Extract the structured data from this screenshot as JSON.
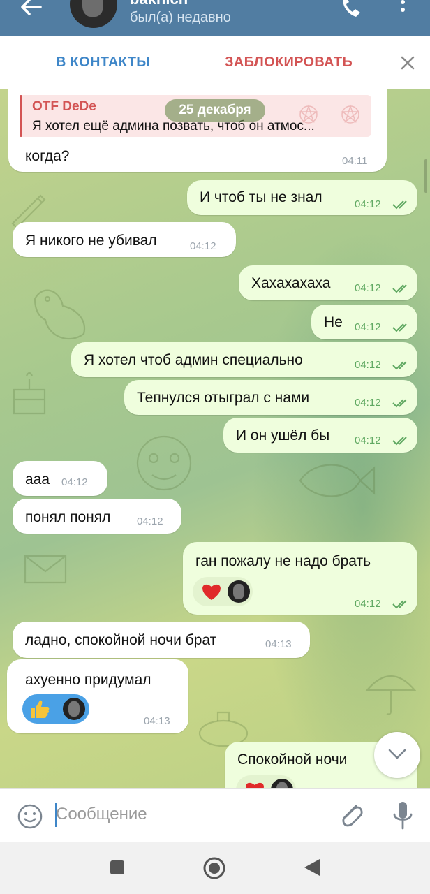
{
  "header": {
    "name": "bakhich",
    "status": "был(а) недавно"
  },
  "actions": {
    "add_contact": "В КОНТАКТЫ",
    "block": "ЗАБЛОКИРОВАТЬ"
  },
  "date_label": "25 декабря",
  "messages": [
    {
      "side": "in",
      "reply_to": {
        "name": "OTF DeDe",
        "text": "Я хотел ещё админа позвать, чтоб он атмос..."
      },
      "text": "когда?",
      "time": "04:11"
    },
    {
      "side": "out",
      "text": "И чтоб ты не знал",
      "time": "04:12",
      "read": true
    },
    {
      "side": "in",
      "text": "Я никого не убивал",
      "time": "04:12"
    },
    {
      "side": "out",
      "text": "Хахахахаха",
      "time": "04:12",
      "read": true
    },
    {
      "side": "out",
      "text": "Не",
      "time": "04:12",
      "read": true
    },
    {
      "side": "out",
      "text": "Я хотел чтоб админ специально",
      "time": "04:12",
      "read": true
    },
    {
      "side": "out",
      "text": "Тепнулся отыграл с нами",
      "time": "04:12",
      "read": true
    },
    {
      "side": "out",
      "text": "И он ушёл бы",
      "time": "04:12",
      "read": true
    },
    {
      "side": "in",
      "text": "ааа",
      "time": "04:12"
    },
    {
      "side": "in",
      "text": "понял понял",
      "time": "04:12"
    },
    {
      "side": "out",
      "text": "ган пожалу не надо брать",
      "time": "04:12",
      "read": true,
      "reaction": "red-heart"
    },
    {
      "side": "in",
      "text": "ладно, спокойной ночи брат",
      "time": "04:13"
    },
    {
      "side": "in",
      "text": "ахуенно придумал",
      "time": "04:13",
      "reaction": "thumbs-up"
    },
    {
      "side": "out",
      "text": "Спокойной ночи",
      "reaction": "red-heart"
    }
  ],
  "input": {
    "placeholder": "Сообщение"
  },
  "colors": {
    "header": "#517da2",
    "outgoing_bubble": "#effedd",
    "incoming_bubble": "#ffffff",
    "accent": "#3e86c8",
    "danger": "#d35454"
  }
}
